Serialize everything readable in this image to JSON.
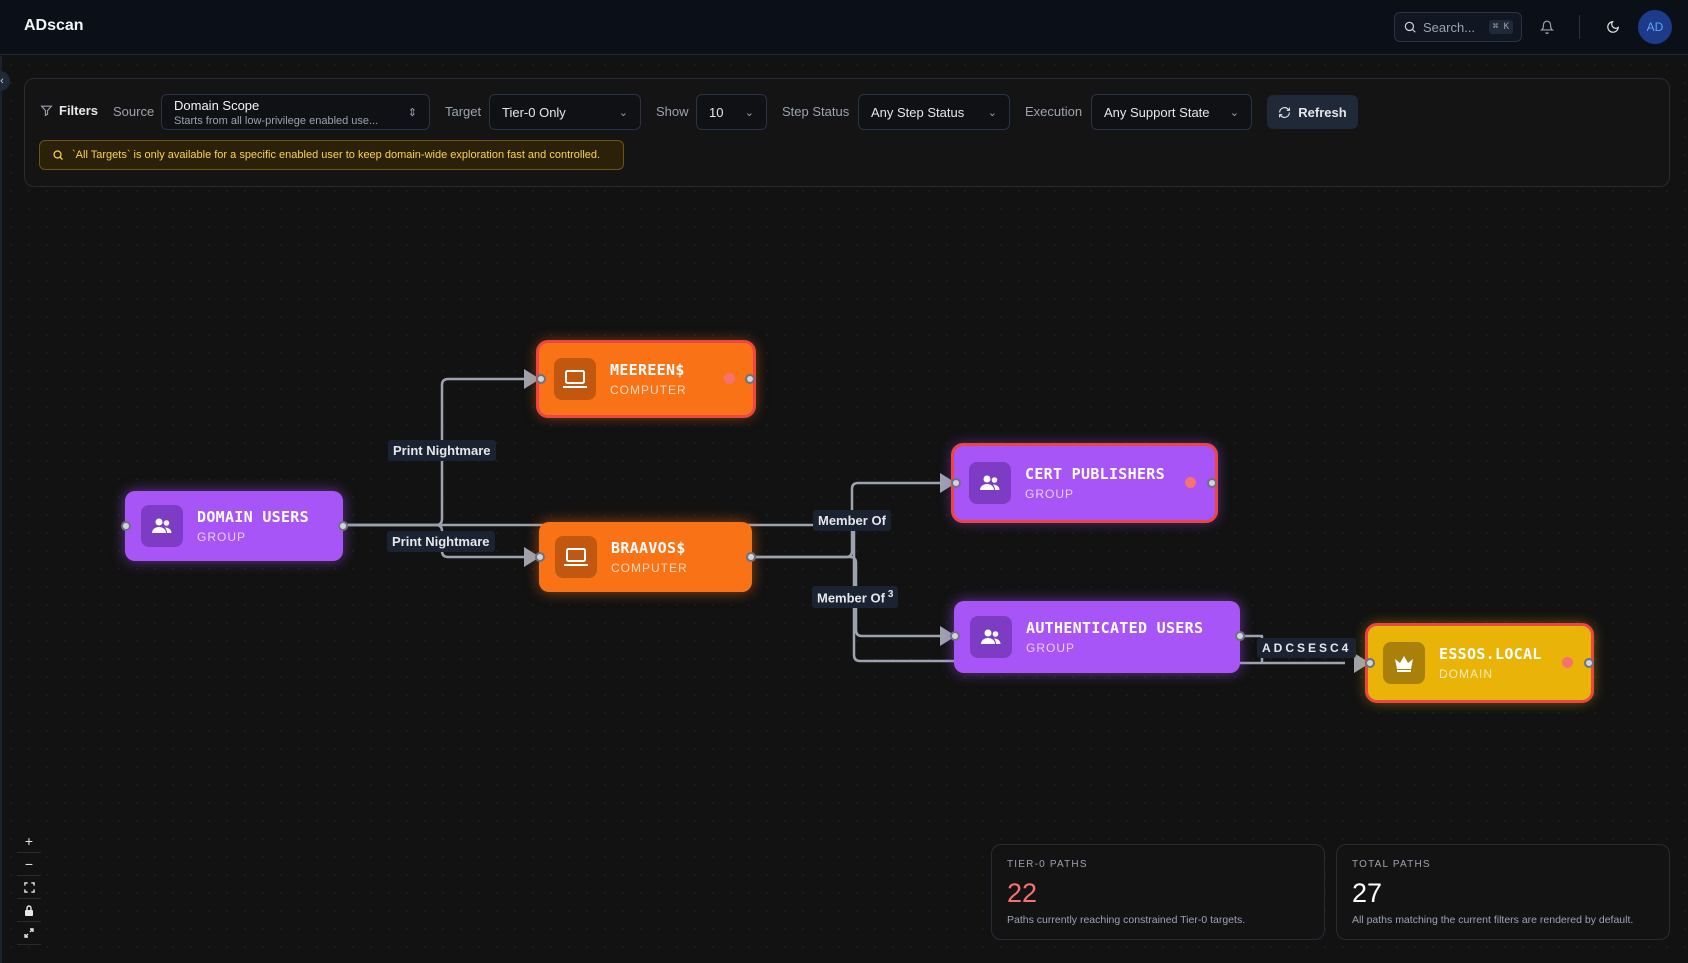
{
  "app": {
    "title": "ADscan"
  },
  "header": {
    "search_placeholder": "Search...",
    "search_shortcut": "⌘ K",
    "avatar_initials": "AD"
  },
  "filters": {
    "title": "Filters",
    "source": {
      "label": "Source",
      "value": "Domain Scope",
      "description": "Starts from all low-privilege enabled use..."
    },
    "target": {
      "label": "Target",
      "value": "Tier-0 Only"
    },
    "show": {
      "label": "Show",
      "value": "10"
    },
    "step_status": {
      "label": "Step Status",
      "value": "Any Step Status"
    },
    "execution": {
      "label": "Execution",
      "value": "Any Support State"
    },
    "refresh_label": "Refresh",
    "notice": "`All Targets` is only available for a specific enabled user to keep domain-wide exploration fast and controlled."
  },
  "graph": {
    "nodes": [
      {
        "id": "domain_users",
        "name": "DOMAIN USERS",
        "type": "GROUP",
        "kind": "group",
        "is_target": false,
        "icon": "users-icon"
      },
      {
        "id": "meereen",
        "name": "MEEREEN$",
        "type": "COMPUTER",
        "kind": "computer",
        "is_target": true,
        "icon": "laptop-icon"
      },
      {
        "id": "braavos",
        "name": "BRAAVOS$",
        "type": "COMPUTER",
        "kind": "computer",
        "is_target": false,
        "icon": "laptop-icon"
      },
      {
        "id": "cert_publishers",
        "name": "CERT PUBLISHERS",
        "type": "GROUP",
        "kind": "group",
        "is_target": true,
        "icon": "users-icon"
      },
      {
        "id": "authenticated_users",
        "name": "AUTHENTICATED USERS",
        "type": "GROUP",
        "kind": "group",
        "is_target": false,
        "icon": "users-icon"
      },
      {
        "id": "essos_local",
        "name": "ESSOS.LOCAL",
        "type": "DOMAIN",
        "kind": "domain",
        "is_target": true,
        "icon": "crown-icon"
      }
    ],
    "edge_labels": {
      "print_nightmare_1": "Print Nightmare",
      "print_nightmare_2": "Print Nightmare",
      "member_of_1": "Member Of",
      "member_of_2": "Member Of",
      "member_of_2_count": "3",
      "adcs_esc4": "ADCSESC4"
    }
  },
  "stats": {
    "tier0": {
      "label": "TIER-0 PATHS",
      "value": "22",
      "description": "Paths currently reaching constrained Tier-0 targets.",
      "color": "#f87171"
    },
    "total": {
      "label": "TOTAL PATHS",
      "value": "27",
      "description": "All paths matching the current filters are rendered by default.",
      "color": "#ffffff"
    }
  },
  "colors": {
    "group": "#a855f7",
    "computer": "#f97316",
    "domain": "#eab308",
    "target_ring": "#ef4444",
    "edge": "#9ca3af"
  }
}
